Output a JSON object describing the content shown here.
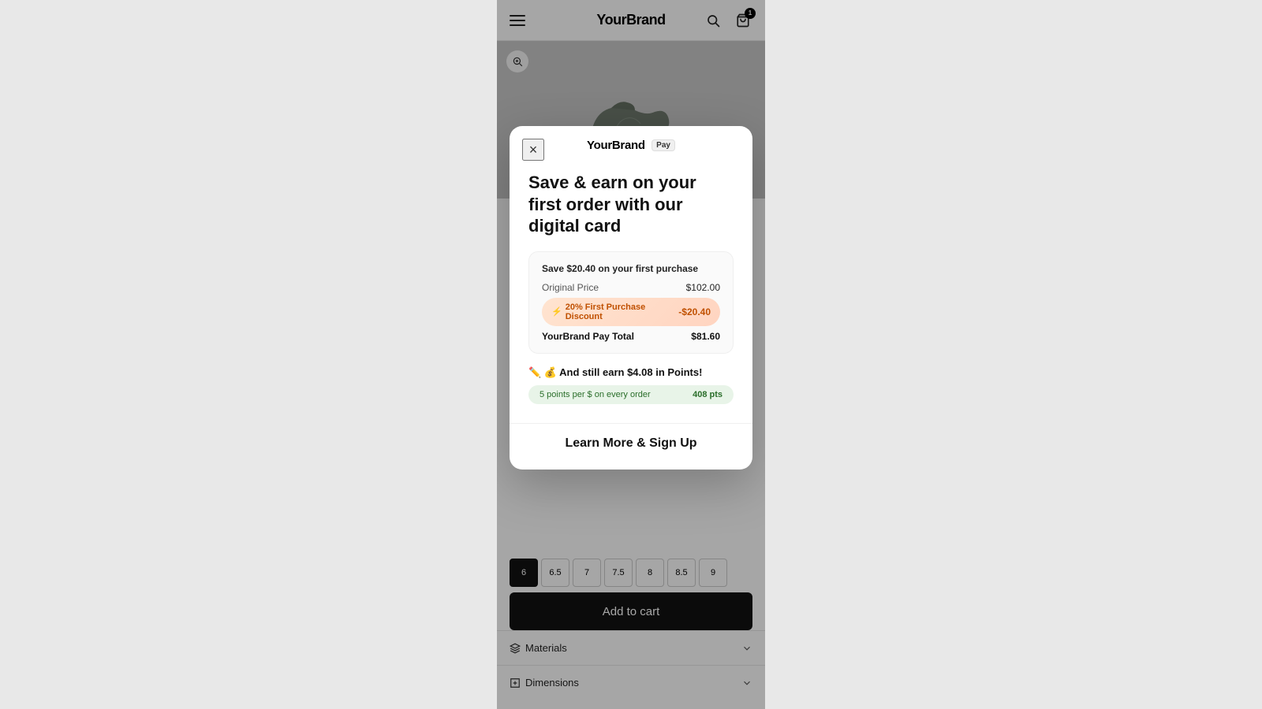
{
  "header": {
    "logo": "YourBrand",
    "cart_count": "1"
  },
  "product": {
    "zoom_label": "zoom",
    "sizes": [
      "6",
      "6.5",
      "7",
      "7.5",
      "8",
      "8.5",
      "9"
    ],
    "active_size_index": 0,
    "add_to_cart_label": "Add to cart"
  },
  "accordion": {
    "materials_label": "Materials",
    "dimensions_label": "Dimensions"
  },
  "modal": {
    "brand": "YourBrand",
    "pay_badge": "Pay",
    "close_label": "×",
    "title": "Save & earn on your first order with our digital card",
    "savings_card": {
      "header": "Save $20.40 on your first purchase",
      "original_price_label": "Original Price",
      "original_price_value": "$102.00",
      "discount_label": "20% First Purchase Discount",
      "discount_value": "-$20.40",
      "total_label": "YourBrand Pay Total",
      "total_value": "$81.60"
    },
    "points_heading": "✏️ 💰 And still earn $4.08 in Points!",
    "points_pill_desc": "5 points per $ on every order",
    "points_pill_value": "408 pts",
    "cta_label": "Learn More & Sign Up"
  }
}
